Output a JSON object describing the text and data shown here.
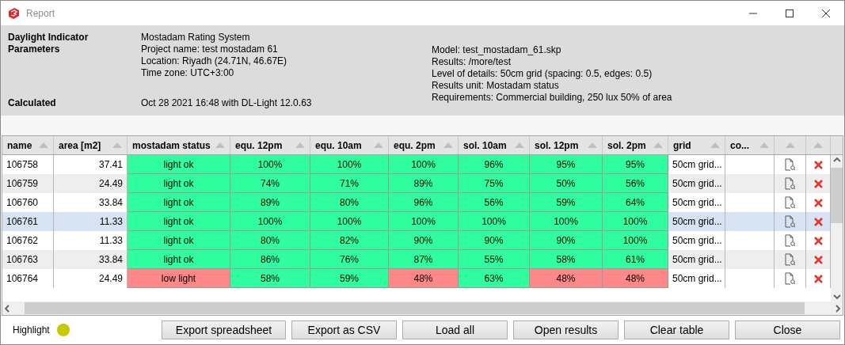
{
  "window": {
    "title": "Report"
  },
  "info": {
    "labels": [
      "Daylight Indicator",
      "Parameters"
    ],
    "system_lines": [
      "Mostadam Rating System",
      "Project name: test mostadam 61",
      "Location: Riyadh (24.71N, 46.67E)",
      "Time zone: UTC+3:00"
    ],
    "model_lines": [
      "Model: test_mostadam_61.skp",
      "Results: /more/test",
      "Level of details: 50cm grid (spacing: 0.5, edges: 0.5)",
      "Results unit: Mostadam status",
      "Requirements: Commercial building, 250 lux 50% of area"
    ],
    "calculated_label": "Calculated",
    "calculated_value": "Oct 28 2021 16:48 with DL-Light 12.0.63"
  },
  "table": {
    "columns": [
      "name",
      "area [m2]",
      "mostadam status",
      "equ. 12pm",
      "equ. 10am",
      "equ. 2pm",
      "sol. 10am",
      "sol. 12pm",
      "sol. 2pm",
      "grid",
      "co..."
    ],
    "rows": [
      {
        "name": "106758",
        "area": "37.41",
        "status": {
          "text": "light ok",
          "ok": true
        },
        "values": [
          {
            "text": "100%",
            "ok": true
          },
          {
            "text": "100%",
            "ok": true
          },
          {
            "text": "100%",
            "ok": true
          },
          {
            "text": "96%",
            "ok": true
          },
          {
            "text": "95%",
            "ok": true
          },
          {
            "text": "95%",
            "ok": true
          }
        ],
        "grid": "50cm grid...",
        "selected": false
      },
      {
        "name": "106759",
        "area": "24.49",
        "status": {
          "text": "light ok",
          "ok": true
        },
        "values": [
          {
            "text": "74%",
            "ok": true
          },
          {
            "text": "71%",
            "ok": true
          },
          {
            "text": "89%",
            "ok": true
          },
          {
            "text": "75%",
            "ok": true
          },
          {
            "text": "50%",
            "ok": true
          },
          {
            "text": "56%",
            "ok": true
          }
        ],
        "grid": "50cm grid...",
        "selected": false
      },
      {
        "name": "106760",
        "area": "33.84",
        "status": {
          "text": "light ok",
          "ok": true
        },
        "values": [
          {
            "text": "89%",
            "ok": true
          },
          {
            "text": "80%",
            "ok": true
          },
          {
            "text": "96%",
            "ok": true
          },
          {
            "text": "56%",
            "ok": true
          },
          {
            "text": "59%",
            "ok": true
          },
          {
            "text": "64%",
            "ok": true
          }
        ],
        "grid": "50cm grid...",
        "selected": false
      },
      {
        "name": "106761",
        "area": "11.33",
        "status": {
          "text": "light ok",
          "ok": true
        },
        "values": [
          {
            "text": "100%",
            "ok": true
          },
          {
            "text": "100%",
            "ok": true
          },
          {
            "text": "100%",
            "ok": true
          },
          {
            "text": "100%",
            "ok": true
          },
          {
            "text": "100%",
            "ok": true
          },
          {
            "text": "100%",
            "ok": true
          }
        ],
        "grid": "50cm grid...",
        "selected": true
      },
      {
        "name": "106762",
        "area": "11.33",
        "status": {
          "text": "light ok",
          "ok": true
        },
        "values": [
          {
            "text": "80%",
            "ok": true
          },
          {
            "text": "82%",
            "ok": true
          },
          {
            "text": "90%",
            "ok": true
          },
          {
            "text": "90%",
            "ok": true
          },
          {
            "text": "90%",
            "ok": true
          },
          {
            "text": "100%",
            "ok": true
          }
        ],
        "grid": "50cm grid...",
        "selected": false
      },
      {
        "name": "106763",
        "area": "33.84",
        "status": {
          "text": "light ok",
          "ok": true
        },
        "values": [
          {
            "text": "86%",
            "ok": true
          },
          {
            "text": "76%",
            "ok": true
          },
          {
            "text": "87%",
            "ok": true
          },
          {
            "text": "55%",
            "ok": true
          },
          {
            "text": "58%",
            "ok": true
          },
          {
            "text": "61%",
            "ok": true
          }
        ],
        "grid": "50cm grid...",
        "selected": false
      },
      {
        "name": "106764",
        "area": "24.49",
        "status": {
          "text": "low light",
          "ok": false
        },
        "values": [
          {
            "text": "58%",
            "ok": true
          },
          {
            "text": "59%",
            "ok": true
          },
          {
            "text": "48%",
            "ok": false
          },
          {
            "text": "63%",
            "ok": true
          },
          {
            "text": "48%",
            "ok": false
          },
          {
            "text": "48%",
            "ok": false
          }
        ],
        "grid": "50cm grid...",
        "selected": false
      }
    ]
  },
  "footer": {
    "highlight_label": "Highlight",
    "buttons": [
      "Export spreadsheet",
      "Export as CSV",
      "Load all",
      "Open results",
      "Clear table",
      "Close"
    ]
  }
}
